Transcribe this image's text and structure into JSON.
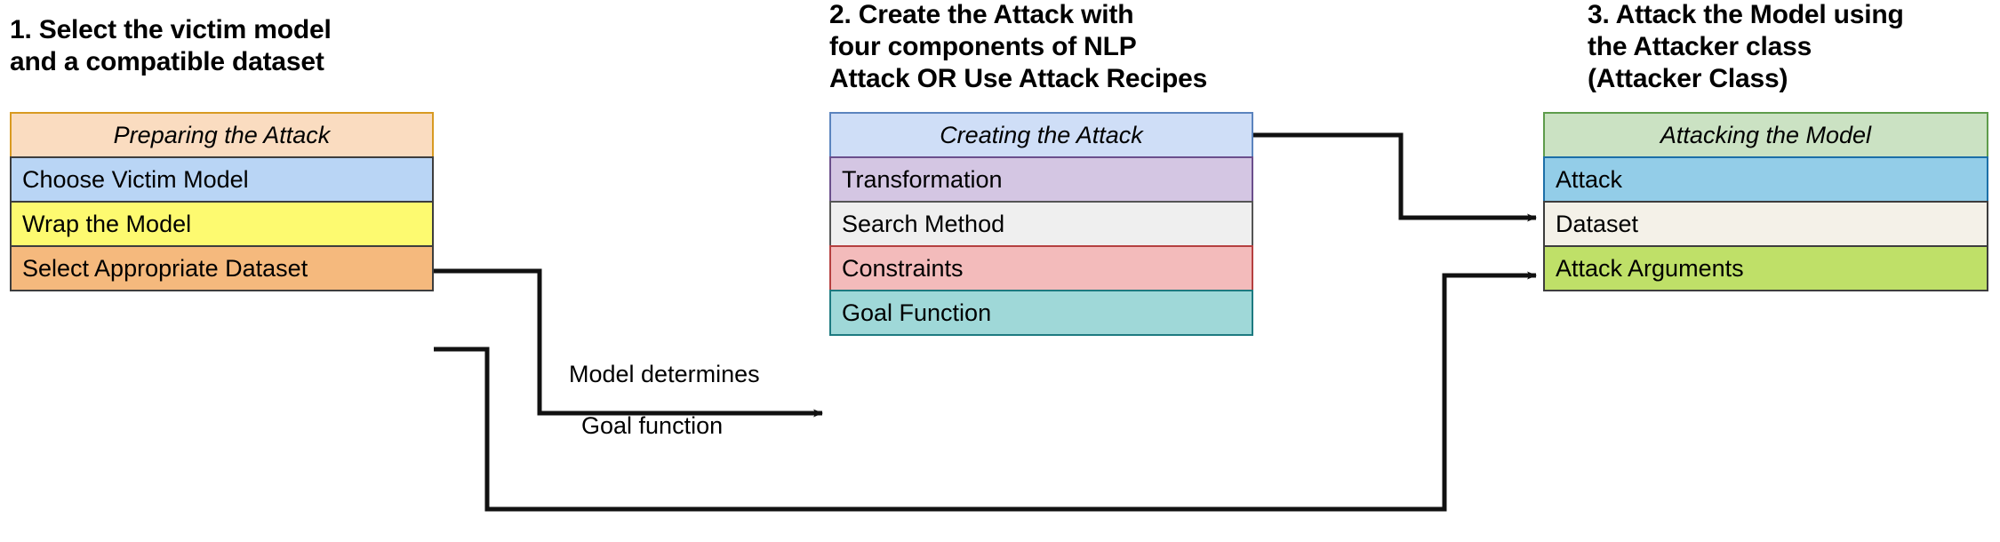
{
  "diagram": {
    "title_note": "TextAttack pipeline overview",
    "columns": [
      {
        "heading": "1. Select the victim model\nand a compatible dataset",
        "nodes": [
          {
            "label": "Preparing the Attack",
            "role": "title",
            "fill": "#fadcc0",
            "border": "#d89a21"
          },
          {
            "label": "Choose Victim Model",
            "role": "item",
            "fill": "#b9d5f5",
            "border": "#3d3d3d"
          },
          {
            "label": "Wrap the Model",
            "role": "item",
            "fill": "#fdfa70",
            "border": "#3d3d3d"
          },
          {
            "label": "Select Appropriate Dataset",
            "role": "item",
            "fill": "#f5b97d",
            "border": "#3d3d3d"
          }
        ]
      },
      {
        "heading": "2. Create the Attack with\nfour components of NLP\nAttack OR Use Attack Recipes",
        "nodes": [
          {
            "label": "Creating the Attack",
            "role": "title",
            "fill": "#cfdef7",
            "border": "#5b84be"
          },
          {
            "label": "Transformation",
            "role": "item",
            "fill": "#d4c6e3",
            "border": "#6b4f8c"
          },
          {
            "label": "Search Method",
            "role": "item",
            "fill": "#efefef",
            "border": "#555555"
          },
          {
            "label": "Constraints",
            "role": "item",
            "fill": "#f3bbbb",
            "border": "#b54040"
          },
          {
            "label": "Goal Function",
            "role": "item",
            "fill": "#9fd8d8",
            "border": "#1d7a80"
          }
        ]
      },
      {
        "heading": "3. Attack the Model using\nthe Attacker class\n(Attacker Class)",
        "nodes": [
          {
            "label": "Attacking the Model",
            "role": "title",
            "fill": "#cbe2c3",
            "border": "#5e9c4b"
          },
          {
            "label": "Attack",
            "role": "item",
            "fill": "#93cde8",
            "border": "#1c6fa8"
          },
          {
            "label": "Dataset",
            "role": "item",
            "fill": "#f4f1e8",
            "border": "#3d3d3d"
          },
          {
            "label": "Attack Arguments",
            "role": "item",
            "fill": "#bfe068",
            "border": "#3d3d3d"
          }
        ]
      }
    ],
    "edge_labels": {
      "model_determines": "Model determines",
      "goal_function": "Goal function"
    },
    "edges": [
      {
        "name": "wrap-model-to-goal-function",
        "from": "Wrap the Model",
        "to": "Goal Function"
      },
      {
        "name": "creating-attack-to-attack",
        "from": "Creating the Attack",
        "to": "Attack"
      },
      {
        "name": "dataset-to-dataset",
        "from": "Select Appropriate Dataset",
        "to": "Dataset"
      }
    ],
    "colors": {
      "line": "#111111",
      "background": "#ffffff",
      "text": "#000000"
    }
  }
}
